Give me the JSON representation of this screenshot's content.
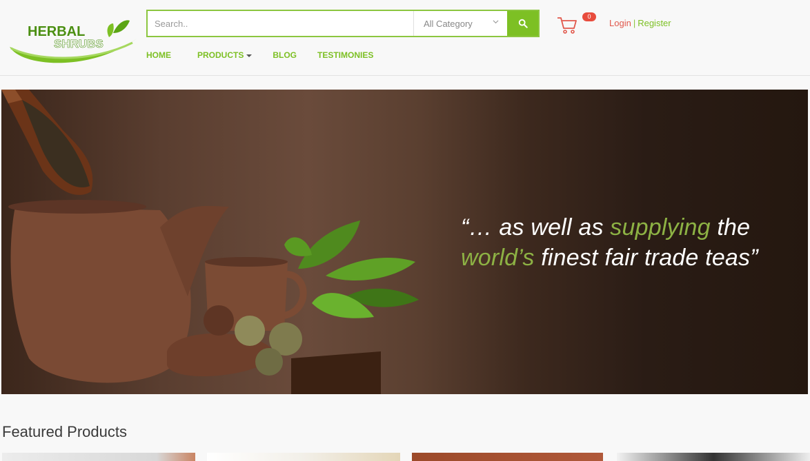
{
  "brand": {
    "logo_line1": "HERBAL",
    "logo_line2": "SHRUBS",
    "accent": "#7dc024",
    "alert": "#e84c3d"
  },
  "search": {
    "placeholder": "Search..",
    "category": "All Category",
    "icon": "search-icon"
  },
  "cart": {
    "icon": "cart-icon",
    "count": "0"
  },
  "auth": {
    "login": "Login",
    "separator": "|",
    "register": "Register"
  },
  "nav": {
    "items": [
      {
        "label": "HOME"
      },
      {
        "label": "PRODUCTS"
      },
      {
        "label": "BLOG"
      },
      {
        "label": "TESTIMONIES"
      }
    ]
  },
  "hero": {
    "quote_open": "“… as well as ",
    "quote_highlight1": "supplying",
    "quote_mid1": " the",
    "quote_highlight2": "world’s",
    "quote_mid2": " finest fair trade teas”"
  },
  "featured": {
    "title": "Featured Products"
  }
}
